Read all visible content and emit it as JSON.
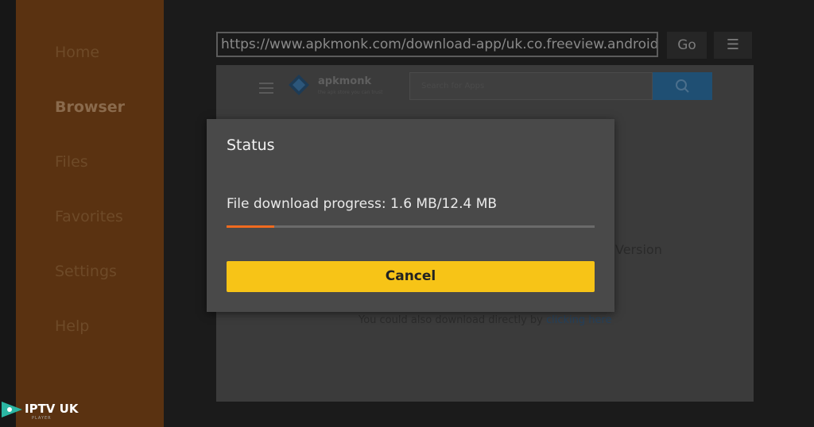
{
  "sidebar": {
    "items": [
      {
        "label": "Home"
      },
      {
        "label": "Browser"
      },
      {
        "label": "Files"
      },
      {
        "label": "Favorites"
      },
      {
        "label": "Settings"
      },
      {
        "label": "Help"
      }
    ],
    "active_index": 1
  },
  "browser": {
    "url": "https://www.apkmonk.com/download-app/uk.co.freeview.android",
    "go_label": "Go",
    "menu_icon": "hamburger-menu-icon"
  },
  "webpage": {
    "site_name": "apkmonk",
    "site_tagline": "the apk store you can trust",
    "search_placeholder": "Search for Apps",
    "version_text": "Version",
    "direct_text": "You could also download directly by",
    "direct_link": "clicking here"
  },
  "dialog": {
    "title": "Status",
    "message": "File download progress: 1.6 MB/12.4 MB",
    "progress_fraction": 0.129,
    "cancel_label": "Cancel"
  },
  "watermark": {
    "brand": "IPTV UK",
    "sub": "PLAYER"
  },
  "colors": {
    "sidebar_bg": "#5a3211",
    "accent_progress": "#f06a1f",
    "cancel_button": "#f7c417",
    "dialog_bg": "#494949"
  }
}
